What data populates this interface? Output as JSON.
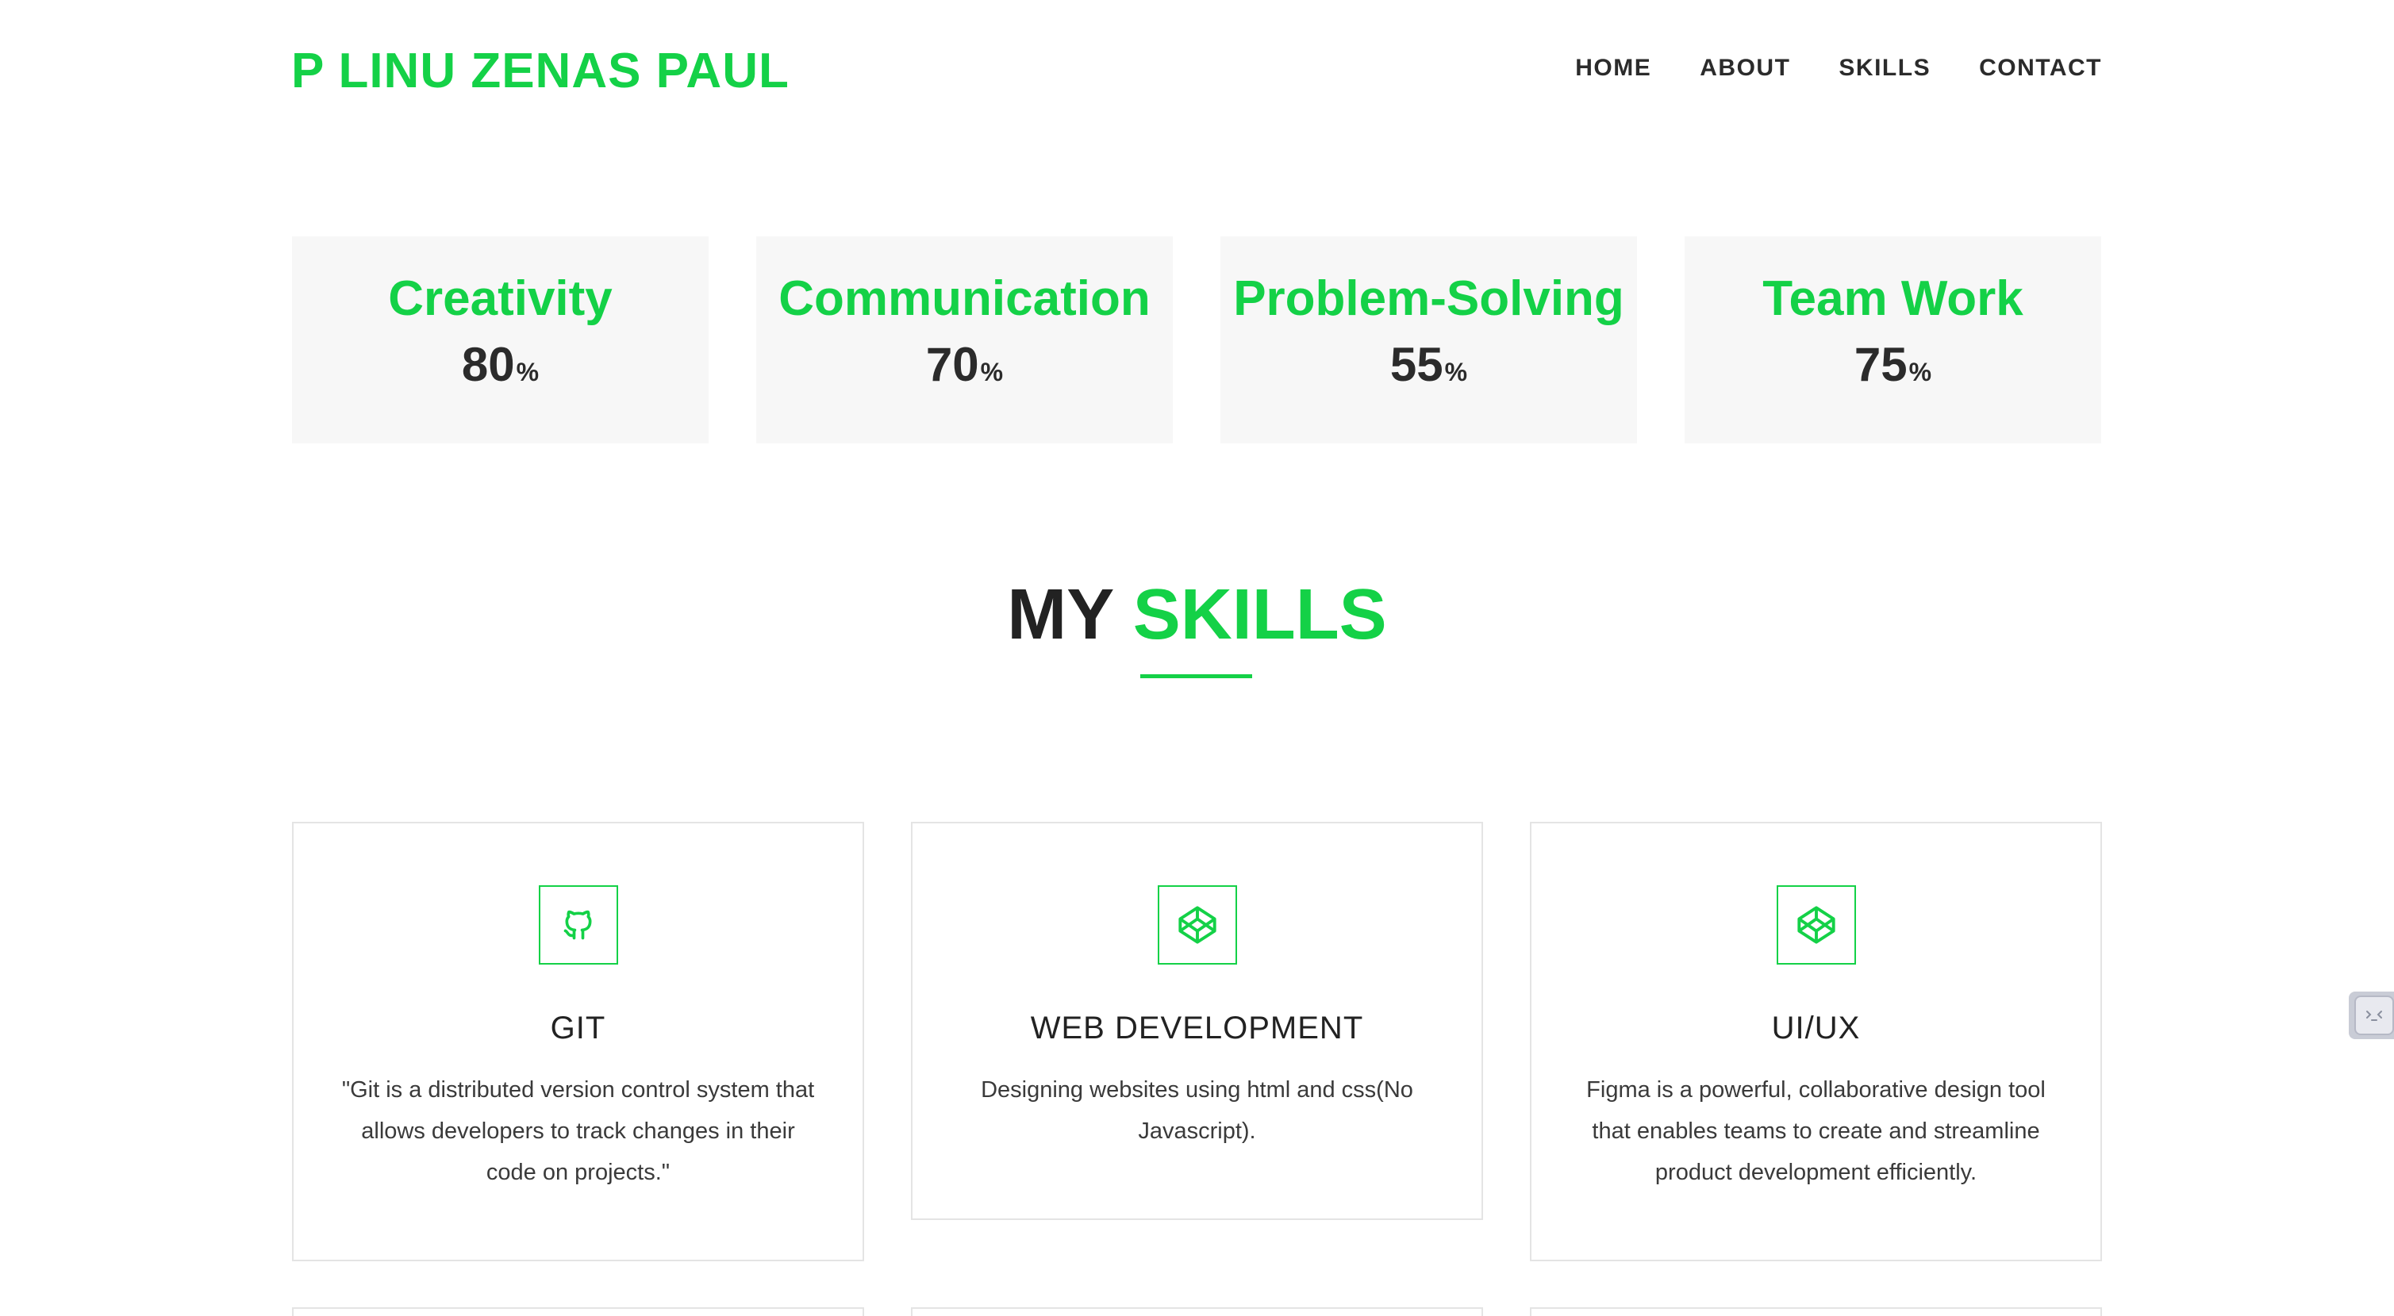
{
  "header": {
    "brand": "P LINU ZENAS PAUL",
    "nav": [
      "HOME",
      "ABOUT",
      "SKILLS",
      "CONTACT"
    ]
  },
  "stats": [
    {
      "title": "Creativity",
      "value": "80",
      "unit": "%"
    },
    {
      "title": "Communication",
      "value": "70",
      "unit": "%"
    },
    {
      "title": "Problem-Solving",
      "value": "55",
      "unit": "%"
    },
    {
      "title": "Team Work",
      "value": "75",
      "unit": "%"
    }
  ],
  "skills_section": {
    "title_part1": "MY",
    "title_part2": "SKILLS"
  },
  "skill_cards": [
    {
      "icon": "github-icon",
      "title": "GIT",
      "description": "\"Git is a distributed version control system that allows developers to track changes in their code on projects.\""
    },
    {
      "icon": "codepen-icon",
      "title": "WEB DEVELOPMENT",
      "description": "Designing websites using html and css(No Javascript)."
    },
    {
      "icon": "codepen-icon",
      "title": "UI/UX",
      "description": "Figma is a powerful, collaborative design tool that enables teams to create and streamline product development efficiently."
    }
  ],
  "colors": {
    "accent": "#14d147",
    "text_dark": "#2b2b2b",
    "stat_bg": "#f7f7f7",
    "card_border": "#e4e4e4"
  }
}
